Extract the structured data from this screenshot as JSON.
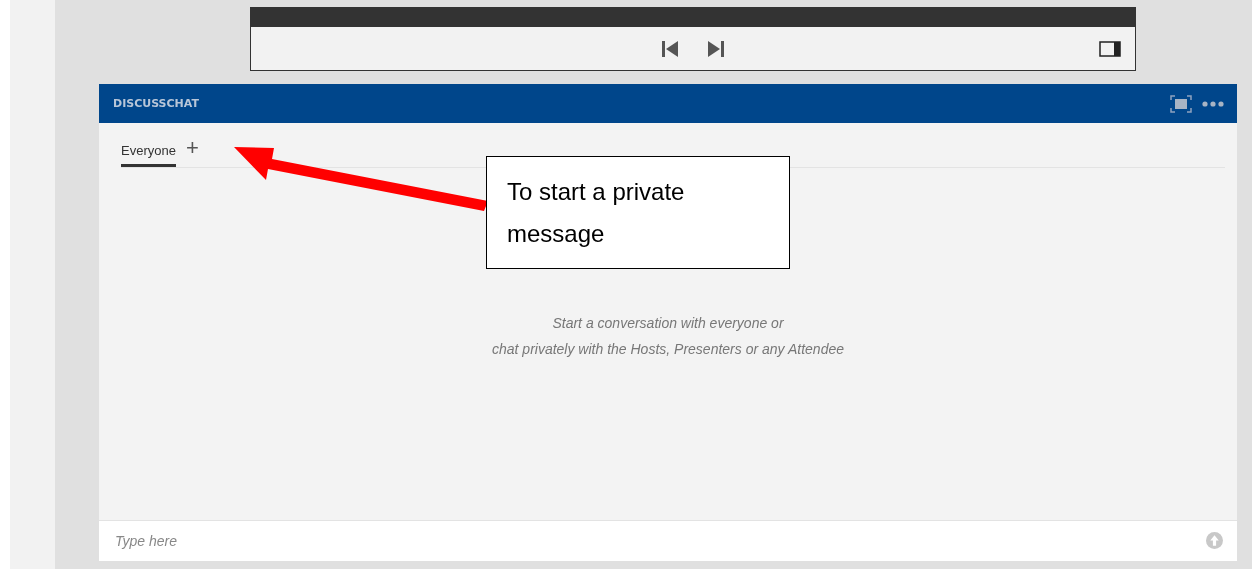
{
  "panel": {
    "title": "DISCUSSCHAT"
  },
  "tabs": [
    {
      "label": "Everyone",
      "selected": true
    }
  ],
  "add_tab": "+",
  "empty_message": "Start a conversation with everyone or\nchat privately with the Hosts, Presenters or any Attendee",
  "input": {
    "placeholder": "Type here"
  },
  "callout": {
    "text": "To start a private message"
  }
}
